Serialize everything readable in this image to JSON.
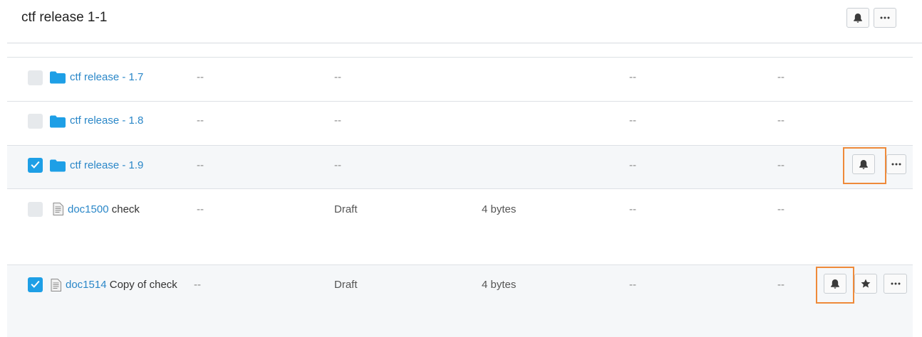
{
  "header": {
    "title": "ctf release 1-1"
  },
  "rows": [
    {
      "name": "ctf release - 1.7",
      "col2": "--",
      "col3": "--",
      "col4": "",
      "col5": "--",
      "col6": "--",
      "selected": false
    },
    {
      "name": "ctf release - 1.8",
      "col2": "--",
      "col3": "--",
      "col4": "",
      "col5": "--",
      "col6": "--",
      "selected": false
    },
    {
      "name": "ctf release - 1.9",
      "col2": "--",
      "col3": "--",
      "col4": "",
      "col5": "--",
      "col6": "--",
      "selected": true
    },
    {
      "id_link": "doc1500",
      "title": "check",
      "col2": "--",
      "col3": "Draft",
      "col4": "4 bytes",
      "col5": "--",
      "col6": "--",
      "selected": false
    },
    {
      "id_link": "doc1514",
      "title": "Copy of check",
      "col2": "--",
      "col3": "Draft",
      "col4": "4 bytes",
      "col5": "--",
      "col6": "--",
      "selected": true
    }
  ],
  "colors": {
    "accent": "#1e9fe6",
    "link": "#2a87c8",
    "highlight": "#ee8a3a",
    "folder": "#1e9fe6"
  }
}
